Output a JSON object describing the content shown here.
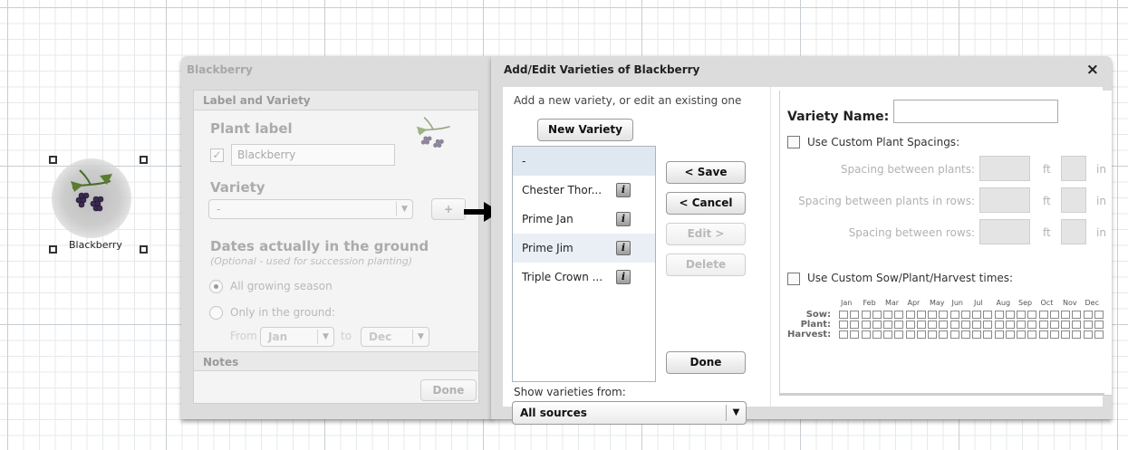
{
  "canvas": {
    "plant_caption": "Blackberry"
  },
  "left_panel": {
    "title": "Blackberry",
    "section_label_variety": "Label and Variety",
    "plant_label_heading": "Plant label",
    "plant_label_value": "Blackberry",
    "plant_label_checked": "✓",
    "variety_heading": "Variety",
    "variety_selected": "-",
    "variety_add": "+",
    "dates_heading": "Dates actually in the ground",
    "dates_subtitle": "(Optional - used for succession planting)",
    "option_all_season": "All growing season",
    "option_only_ground": "Only in the ground:",
    "from_label": "From",
    "from_value": "Jan",
    "to_label": "to",
    "to_value": "Dec",
    "section_notes": "Notes",
    "done_label": "Done"
  },
  "modal": {
    "title": "Add/Edit Varieties of Blackberry",
    "close_glyph": "×",
    "intro": "Add a new variety, or edit an existing one",
    "new_variety_label": "New Variety",
    "varieties": [
      {
        "name": "-"
      },
      {
        "name": "Chester Thor..."
      },
      {
        "name": "Prime Jan"
      },
      {
        "name": "Prime Jim"
      },
      {
        "name": "Triple Crown ..."
      }
    ],
    "info_glyph": "i",
    "save_label": "< Save",
    "cancel_label": "< Cancel",
    "edit_label": "Edit >",
    "delete_label": "Delete",
    "done_label": "Done",
    "show_from_label": "Show varieties from:",
    "sources_value": "All sources",
    "caret": "▼"
  },
  "edit_form": {
    "variety_name_label": "Variety Name:",
    "variety_name_value": "",
    "custom_spacing_label": "Use Custom Plant Spacings:",
    "spacing_plants_label": "Spacing between plants:",
    "spacing_rows_plants_label": "Spacing between plants in rows:",
    "spacing_rows_label": "Spacing between rows:",
    "unit_ft": "ft",
    "unit_in": "in",
    "custom_times_label": "Use Custom Sow/Plant/Harvest times:",
    "months": [
      "Jan",
      "Feb",
      "Mar",
      "Apr",
      "May",
      "Jun",
      "Jul",
      "Aug",
      "Sep",
      "Oct",
      "Nov",
      "Dec"
    ],
    "row_sow": "Sow:",
    "row_plant": "Plant:",
    "row_harvest": "Harvest:"
  },
  "colors": {
    "panel_bg": "#dcdcdc",
    "selected_row": "#dfe8f1",
    "disabled_text": "#b2b2b2"
  }
}
